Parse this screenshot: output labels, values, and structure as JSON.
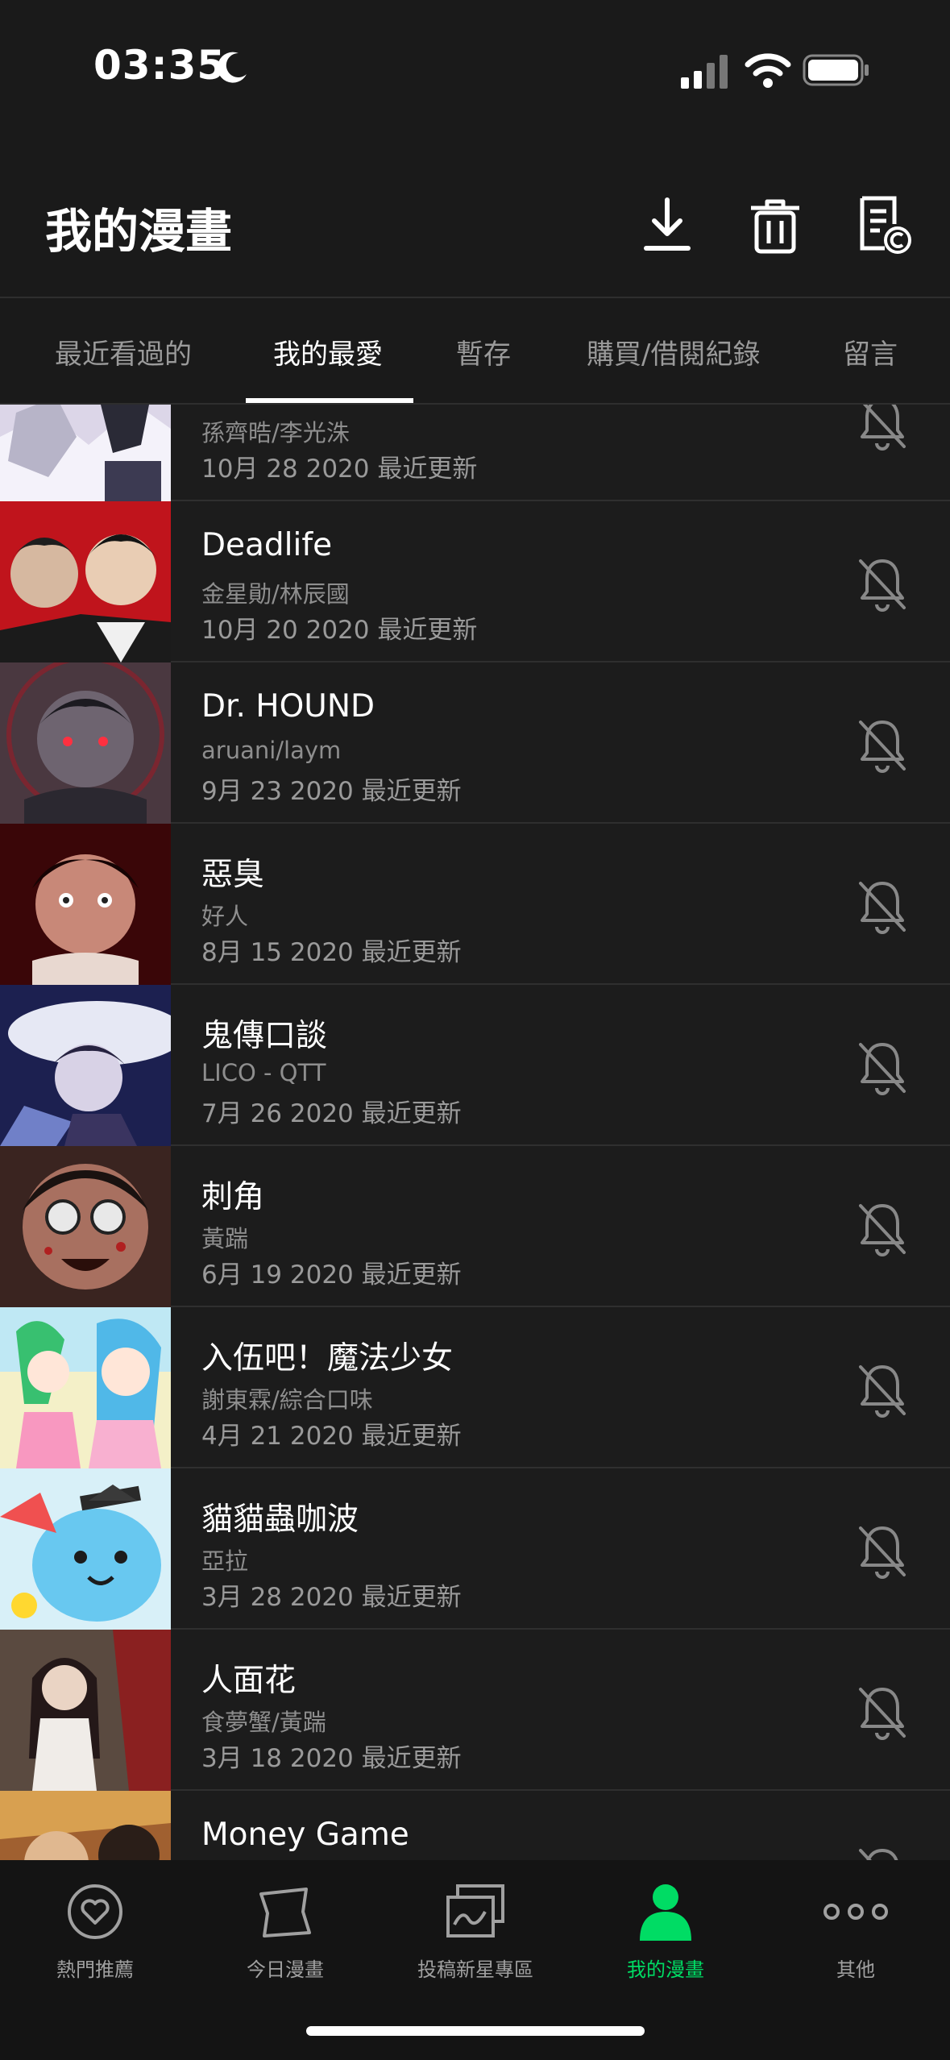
{
  "status_bar": {
    "time": "03:35"
  },
  "header": {
    "title": "我的漫畫"
  },
  "tabs": [
    {
      "label": "最近看過的"
    },
    {
      "label": "我的最愛"
    },
    {
      "label": "暫存"
    },
    {
      "label": "購買/借閱紀錄"
    },
    {
      "label": "留言"
    }
  ],
  "active_tab": "我的最愛",
  "comics": [
    {
      "title": "",
      "author": "孫齊晧/李光洙",
      "date": "10月 28 2020 最近更新"
    },
    {
      "title": "Deadlife",
      "author": "金星勛/林辰國",
      "date": "10月 20 2020 最近更新"
    },
    {
      "title": "Dr. HOUND",
      "author": "aruani/laym",
      "date": "9月 23 2020 最近更新"
    },
    {
      "title": "惡臭",
      "author": "好人",
      "date": "8月 15 2020 最近更新"
    },
    {
      "title": "鬼傳口談",
      "author": "LICO - QTT",
      "date": "7月 26 2020 最近更新"
    },
    {
      "title": "刺角",
      "author": "黃踹",
      "date": "6月 19 2020 最近更新"
    },
    {
      "title": "入伍吧！魔法少女",
      "author": "謝東霖/綜合口味",
      "date": "4月 21 2020 最近更新"
    },
    {
      "title": "貓貓蟲咖波",
      "author": "亞拉",
      "date": "3月 28 2020 最近更新"
    },
    {
      "title": "人面花",
      "author": "食夢蟹/黃踹",
      "date": "3月 18 2020 最近更新"
    },
    {
      "title": "Money Game",
      "author": "",
      "date": ""
    }
  ],
  "bottom_nav": [
    {
      "label": "熱門推薦",
      "icon": "heart-circle-icon"
    },
    {
      "label": "今日漫畫",
      "icon": "book-icon"
    },
    {
      "label": "投稿新星專區",
      "icon": "gallery-icon"
    },
    {
      "label": "我的漫畫",
      "icon": "person-icon"
    },
    {
      "label": "其他",
      "icon": "more-dots-icon"
    }
  ],
  "colors": {
    "accent": "#00dc64",
    "background": "#1a1a1a",
    "muted_text": "#9a9a9a"
  }
}
